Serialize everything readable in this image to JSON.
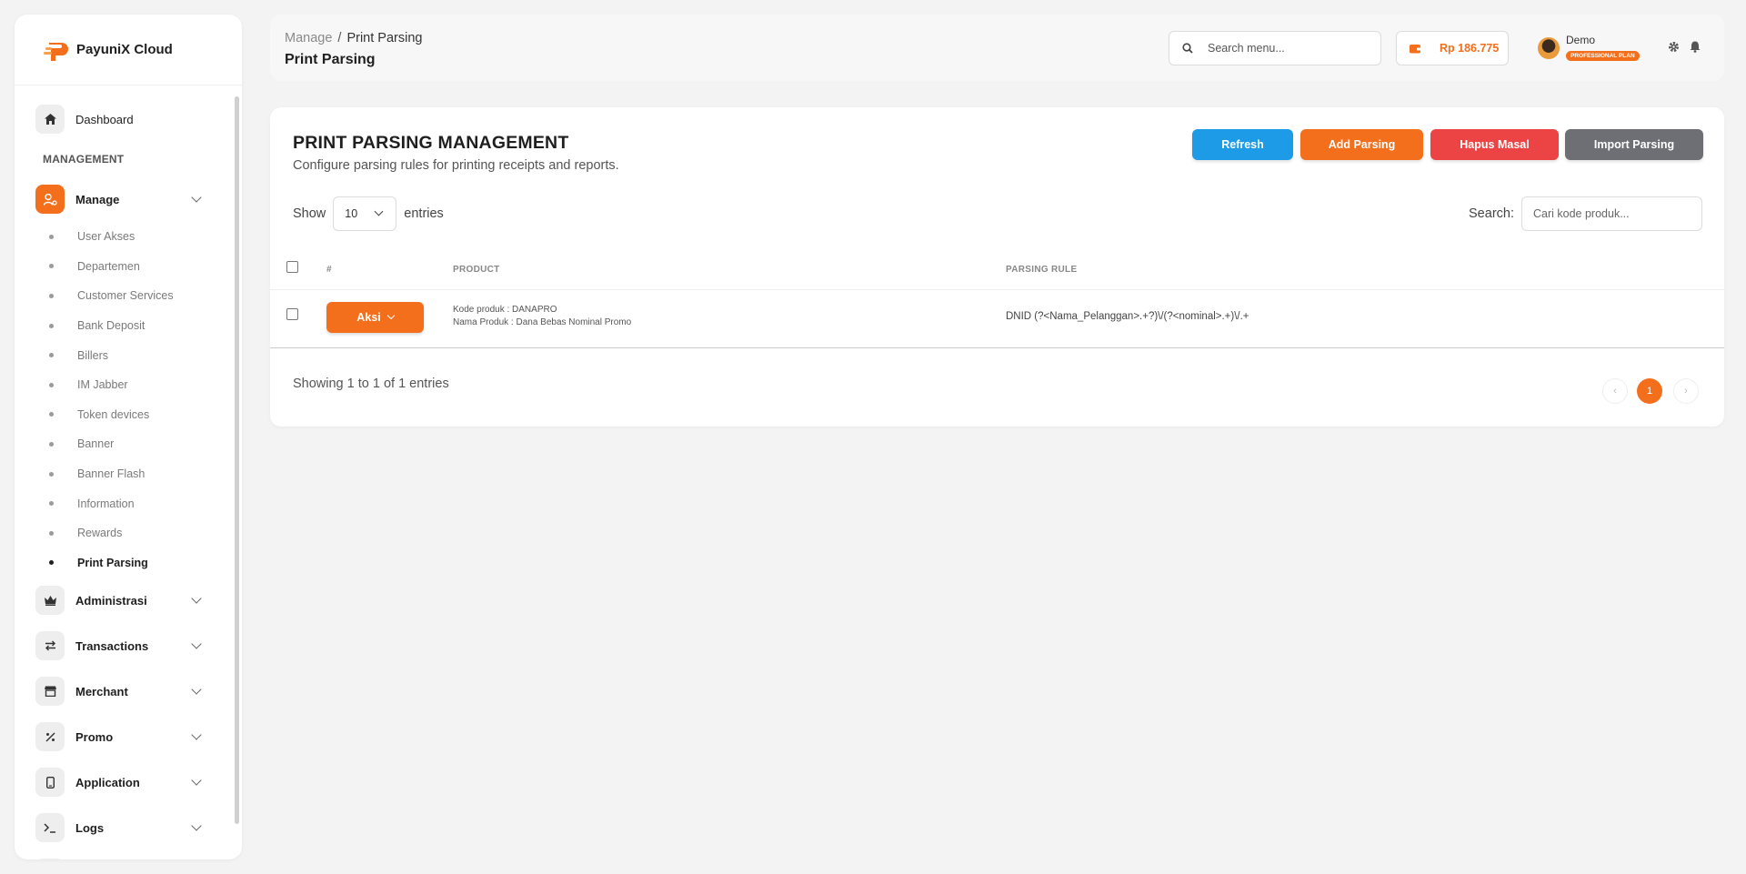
{
  "brand": {
    "name": "PayuniX Cloud"
  },
  "sidebar": {
    "dashboard": "Dashboard",
    "section_title": "MANAGEMENT",
    "manage": "Manage",
    "sub_items": [
      "User Akses",
      "Departemen",
      "Customer Services",
      "Bank Deposit",
      "Billers",
      "IM Jabber",
      "Token devices",
      "Banner",
      "Banner Flash",
      "Information",
      "Rewards",
      "Print Parsing"
    ],
    "active_sub": "Print Parsing",
    "groups": [
      "Administrasi",
      "Transactions",
      "Merchant",
      "Promo",
      "Application",
      "Logs"
    ]
  },
  "header": {
    "breadcrumb_parent": "Manage",
    "breadcrumb_sep": "/",
    "breadcrumb_current": "Print Parsing",
    "page_title": "Print Parsing",
    "search_placeholder": "Search menu...",
    "balance": "Rp 186.775",
    "user_name": "Demo",
    "plan": "PROFESSIONAL PLAN"
  },
  "card": {
    "title": "PRINT PARSING MANAGEMENT",
    "subtitle": "Configure parsing rules for printing receipts and reports.",
    "buttons": {
      "refresh": "Refresh",
      "add": "Add Parsing",
      "delete": "Hapus Masal",
      "import": "Import Parsing"
    },
    "show_label": "Show",
    "page_length": "10",
    "entries_label": "entries",
    "search_label": "Search:",
    "search_placeholder": "Cari kode produk...",
    "columns": {
      "num": "#",
      "product": "PRODUCT",
      "rule": "PARSING RULE"
    },
    "rows": [
      {
        "action": "Aksi",
        "product_code": "Kode produk : DANAPRO",
        "product_name": "Nama Produk : Dana Bebas Nominal Promo",
        "rule": "DNID (?<Nama_Pelanggan>.+?)\\/(?<nominal>.+)\\/.+"
      }
    ],
    "info": "Showing 1 to 1 of 1 entries",
    "pagination": {
      "prev": "‹",
      "current": "1",
      "next": "›"
    }
  },
  "colors": {
    "accent": "#f36f1b",
    "refresh": "#1d9be7",
    "danger": "#ec4444",
    "import": "#6d6f74"
  }
}
